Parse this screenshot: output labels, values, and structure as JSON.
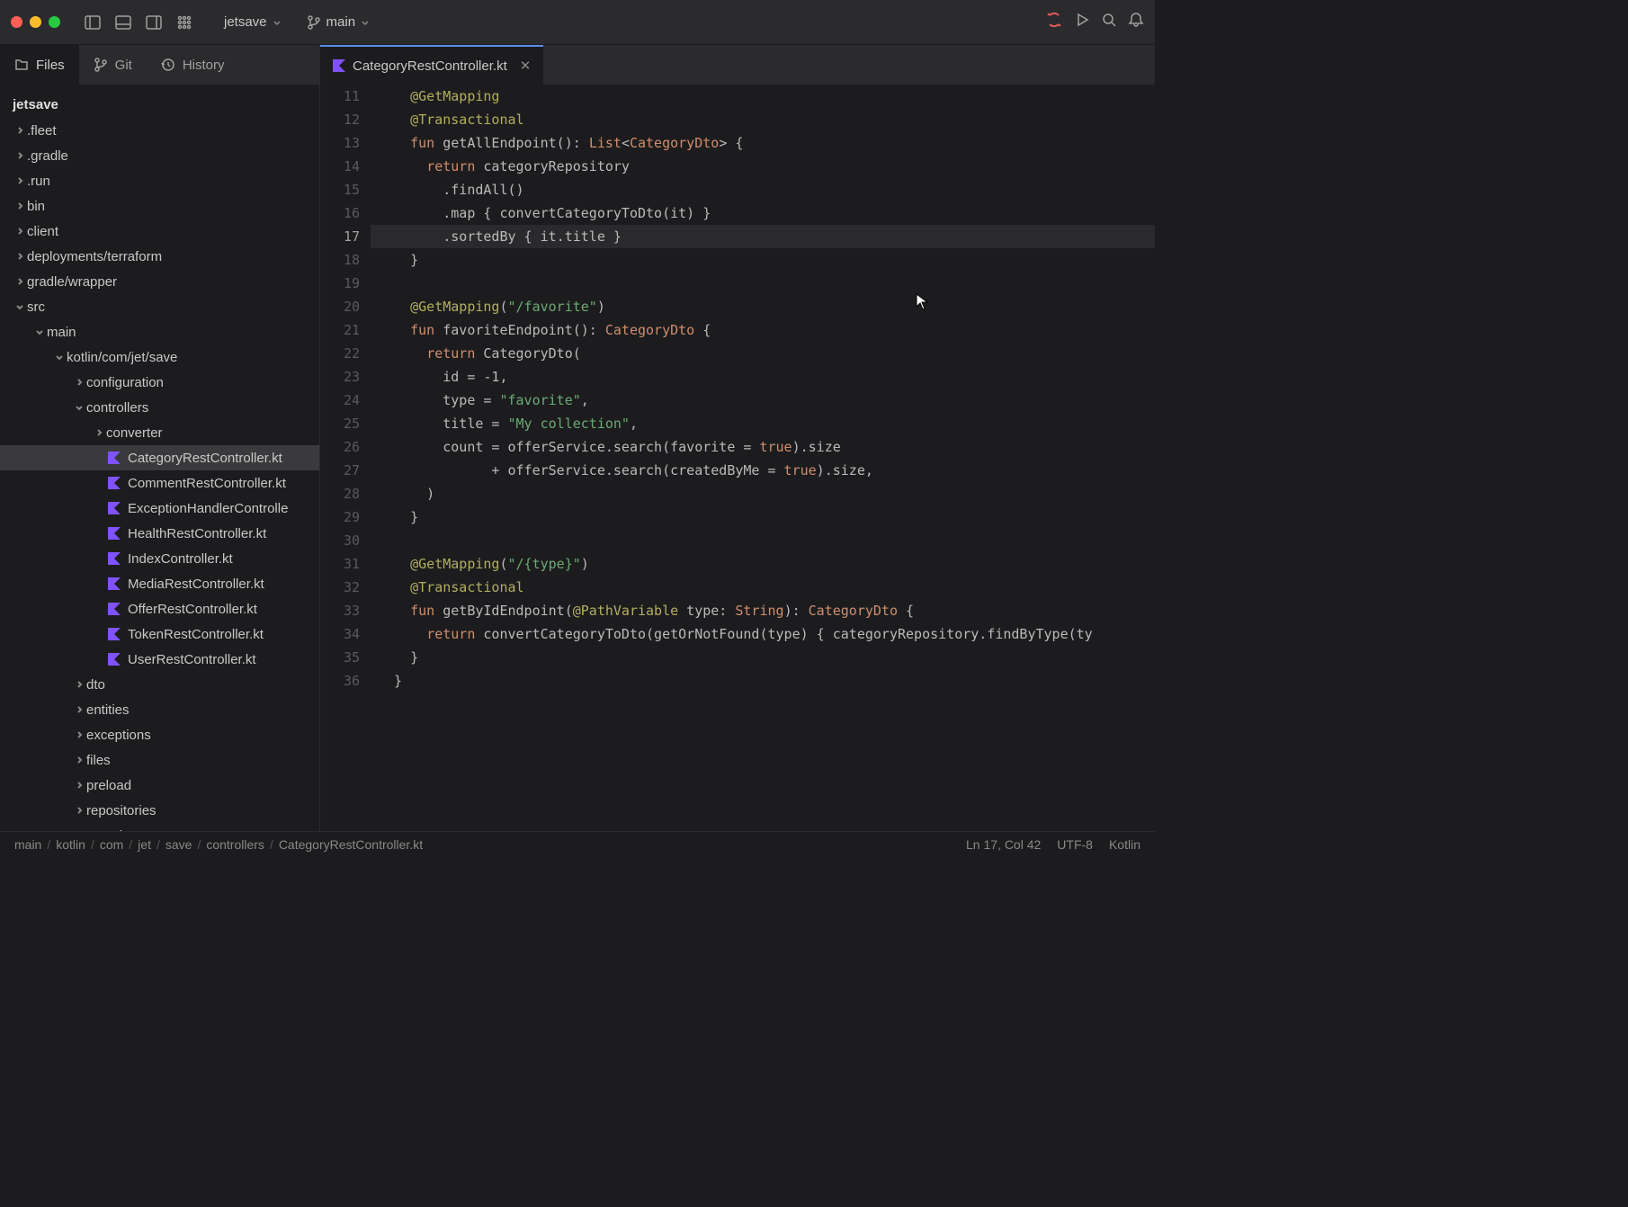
{
  "titlebar": {
    "project": "jetsave",
    "branch": "main"
  },
  "sidebar": {
    "tabs": [
      {
        "label": "Files",
        "active": true
      },
      {
        "label": "Git",
        "active": false
      },
      {
        "label": "History",
        "active": false
      }
    ],
    "root": "jetsave",
    "tree": [
      {
        "label": ".fleet",
        "depth": 0,
        "expanded": false,
        "type": "folder"
      },
      {
        "label": ".gradle",
        "depth": 0,
        "expanded": false,
        "type": "folder"
      },
      {
        "label": ".run",
        "depth": 0,
        "expanded": false,
        "type": "folder"
      },
      {
        "label": "bin",
        "depth": 0,
        "expanded": false,
        "type": "folder"
      },
      {
        "label": "client",
        "depth": 0,
        "expanded": false,
        "type": "folder"
      },
      {
        "label": "deployments/terraform",
        "depth": 0,
        "expanded": false,
        "type": "folder"
      },
      {
        "label": "gradle/wrapper",
        "depth": 0,
        "expanded": false,
        "type": "folder"
      },
      {
        "label": "src",
        "depth": 0,
        "expanded": true,
        "type": "folder"
      },
      {
        "label": "main",
        "depth": 1,
        "expanded": true,
        "type": "folder"
      },
      {
        "label": "kotlin/com/jet/save",
        "depth": 2,
        "expanded": true,
        "type": "folder"
      },
      {
        "label": "configuration",
        "depth": 3,
        "expanded": false,
        "type": "folder"
      },
      {
        "label": "controllers",
        "depth": 3,
        "expanded": true,
        "type": "folder"
      },
      {
        "label": "converter",
        "depth": 4,
        "expanded": false,
        "type": "folder"
      },
      {
        "label": "CategoryRestController.kt",
        "depth": 4,
        "type": "kotlin",
        "selected": true
      },
      {
        "label": "CommentRestController.kt",
        "depth": 4,
        "type": "kotlin"
      },
      {
        "label": "ExceptionHandlerControlle",
        "depth": 4,
        "type": "kotlin"
      },
      {
        "label": "HealthRestController.kt",
        "depth": 4,
        "type": "kotlin"
      },
      {
        "label": "IndexController.kt",
        "depth": 4,
        "type": "kotlin"
      },
      {
        "label": "MediaRestController.kt",
        "depth": 4,
        "type": "kotlin"
      },
      {
        "label": "OfferRestController.kt",
        "depth": 4,
        "type": "kotlin"
      },
      {
        "label": "TokenRestController.kt",
        "depth": 4,
        "type": "kotlin"
      },
      {
        "label": "UserRestController.kt",
        "depth": 4,
        "type": "kotlin"
      },
      {
        "label": "dto",
        "depth": 3,
        "expanded": false,
        "type": "folder"
      },
      {
        "label": "entities",
        "depth": 3,
        "expanded": false,
        "type": "folder"
      },
      {
        "label": "exceptions",
        "depth": 3,
        "expanded": false,
        "type": "folder"
      },
      {
        "label": "files",
        "depth": 3,
        "expanded": false,
        "type": "folder"
      },
      {
        "label": "preload",
        "depth": 3,
        "expanded": false,
        "type": "folder"
      },
      {
        "label": "repositories",
        "depth": 3,
        "expanded": false,
        "type": "folder"
      },
      {
        "label": "security",
        "depth": 3,
        "expanded": false,
        "type": "folder"
      }
    ]
  },
  "editor": {
    "tab": {
      "label": "CategoryRestController.kt"
    },
    "gutter_start": 11,
    "active_line": 17,
    "lines": [
      [
        [
          "    ",
          ""
        ],
        [
          "@",
          "ann"
        ],
        [
          "GetMapping",
          "ann"
        ]
      ],
      [
        [
          "    ",
          ""
        ],
        [
          "@",
          "ann"
        ],
        [
          "Transactional",
          "ann"
        ]
      ],
      [
        [
          "    ",
          ""
        ],
        [
          "fun",
          "kw"
        ],
        [
          " getAllEndpoint(): ",
          ""
        ],
        [
          "List",
          "type"
        ],
        [
          "<",
          ""
        ],
        [
          "CategoryDto",
          "type"
        ],
        [
          "> {",
          ""
        ]
      ],
      [
        [
          "      ",
          ""
        ],
        [
          "return",
          "kw"
        ],
        [
          " categoryRepository",
          ""
        ]
      ],
      [
        [
          "        .findAll()",
          ""
        ]
      ],
      [
        [
          "        .map { convertCategoryToDto(it) }",
          ""
        ]
      ],
      [
        [
          "        .sortedBy { it.title }",
          ""
        ]
      ],
      [
        [
          "    }",
          ""
        ]
      ],
      [
        [
          "",
          ""
        ]
      ],
      [
        [
          "    ",
          ""
        ],
        [
          "@",
          "ann"
        ],
        [
          "GetMapping",
          "ann"
        ],
        [
          "(",
          ""
        ],
        [
          "\"/favorite\"",
          "str"
        ],
        [
          ")",
          ""
        ]
      ],
      [
        [
          "    ",
          ""
        ],
        [
          "fun",
          "kw"
        ],
        [
          " favoriteEndpoint(): ",
          ""
        ],
        [
          "CategoryDto",
          "type"
        ],
        [
          " {",
          ""
        ]
      ],
      [
        [
          "      ",
          ""
        ],
        [
          "return",
          "kw"
        ],
        [
          " CategoryDto(",
          ""
        ]
      ],
      [
        [
          "        id = -1,",
          ""
        ]
      ],
      [
        [
          "        type = ",
          ""
        ],
        [
          "\"favorite\"",
          "str"
        ],
        [
          ",",
          ""
        ]
      ],
      [
        [
          "        title = ",
          ""
        ],
        [
          "\"My collection\"",
          "str"
        ],
        [
          ",",
          ""
        ]
      ],
      [
        [
          "        count = offerService.search(favorite = ",
          ""
        ],
        [
          "true",
          "bool"
        ],
        [
          ").size",
          ""
        ]
      ],
      [
        [
          "              + offerService.search(createdByMe = ",
          ""
        ],
        [
          "true",
          "bool"
        ],
        [
          ").size,",
          ""
        ]
      ],
      [
        [
          "      )",
          ""
        ]
      ],
      [
        [
          "    }",
          ""
        ]
      ],
      [
        [
          "",
          ""
        ]
      ],
      [
        [
          "    ",
          ""
        ],
        [
          "@",
          "ann"
        ],
        [
          "GetMapping",
          "ann"
        ],
        [
          "(",
          ""
        ],
        [
          "\"/{type}\"",
          "str"
        ],
        [
          ")",
          ""
        ]
      ],
      [
        [
          "    ",
          ""
        ],
        [
          "@",
          "ann"
        ],
        [
          "Transactional",
          "ann"
        ]
      ],
      [
        [
          "    ",
          ""
        ],
        [
          "fun",
          "kw"
        ],
        [
          " getByIdEndpoint(",
          ""
        ],
        [
          "@",
          "ann"
        ],
        [
          "PathVariable",
          "ann"
        ],
        [
          " type: ",
          ""
        ],
        [
          "String",
          "type"
        ],
        [
          "): ",
          ""
        ],
        [
          "CategoryDto",
          "type"
        ],
        [
          " {",
          ""
        ]
      ],
      [
        [
          "      ",
          ""
        ],
        [
          "return",
          "kw"
        ],
        [
          " convertCategoryToDto(getOrNotFound(type) { categoryRepository.findByType(ty",
          ""
        ]
      ],
      [
        [
          "    }",
          ""
        ]
      ],
      [
        [
          "  }",
          ""
        ]
      ]
    ]
  },
  "statusbar": {
    "breadcrumb": [
      "main",
      "kotlin",
      "com",
      "jet",
      "save",
      "controllers",
      "CategoryRestController.kt"
    ],
    "position": "Ln 17, Col 42",
    "encoding": "UTF-8",
    "language": "Kotlin"
  }
}
